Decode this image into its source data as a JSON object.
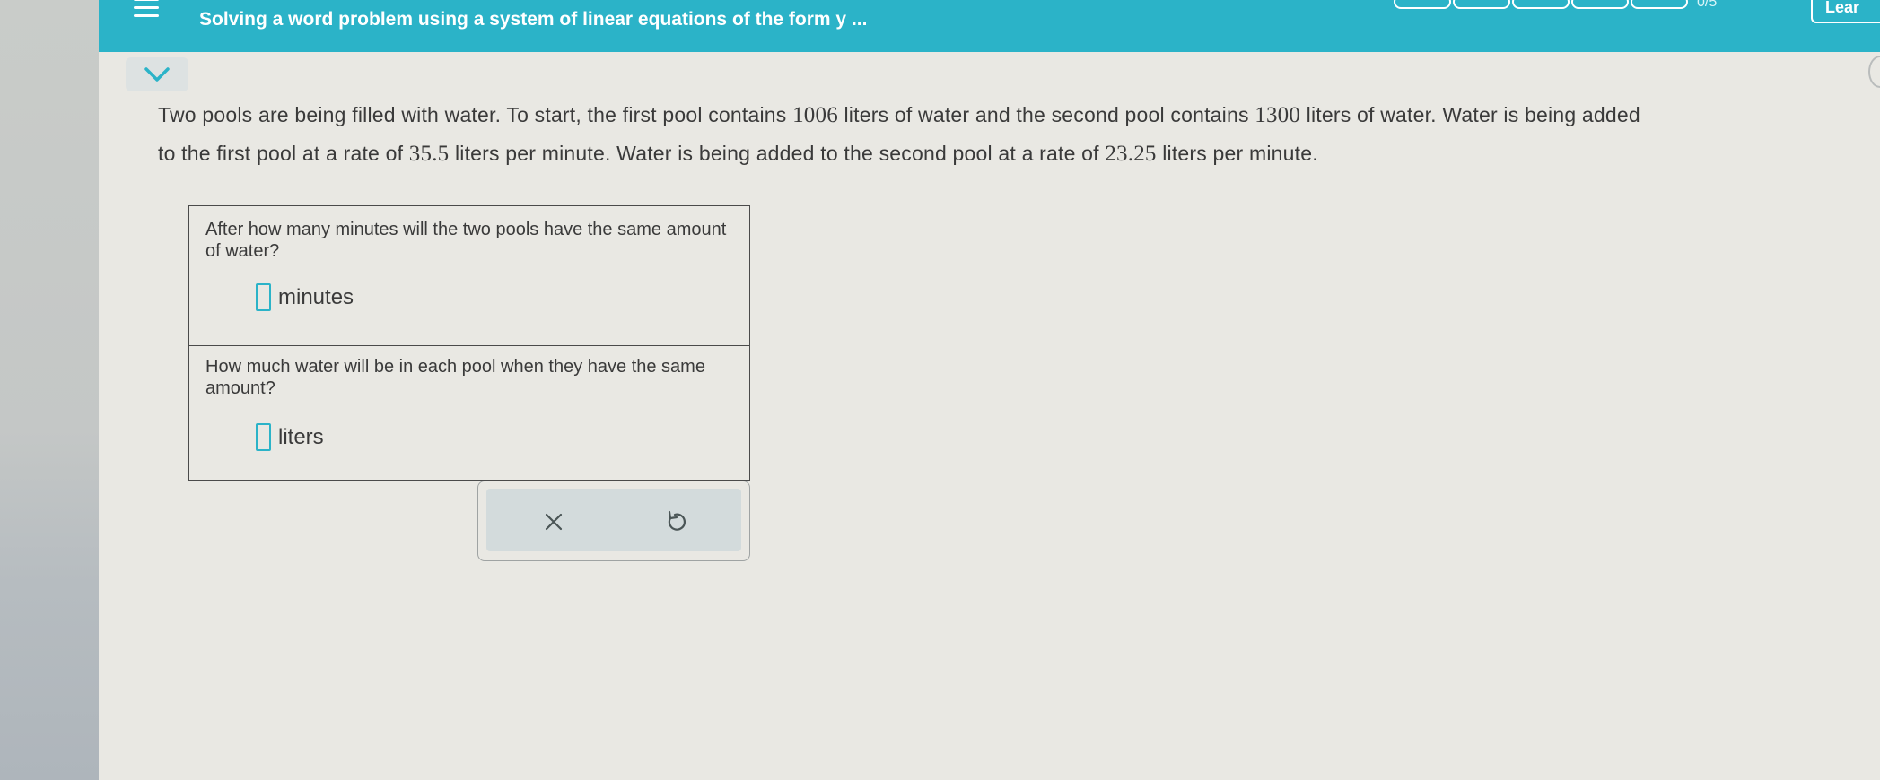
{
  "header": {
    "title": "Solving a word problem using a system of linear equations of the form y ...",
    "progress_count": "0/5",
    "progress_fraction": 0,
    "learn_label": "Lear",
    "accent_color": "#2bb3c8"
  },
  "problem": {
    "line1_a": "Two pools are being filled with water. To start, the first pool contains ",
    "line1_n1": "1006",
    "line1_b": " liters of water and the second pool contains ",
    "line1_n2": "1300",
    "line1_c": " liters of water. Water is being added",
    "line2_a": "to the first pool at a rate of ",
    "line2_n1": "35.5",
    "line2_b": " liters per minute. Water is being added to the second pool at a rate of ",
    "line2_n2": "23.25",
    "line2_c": " liters per minute."
  },
  "questions": [
    {
      "text": "After how many minutes will the two pools have the same amount of water?",
      "answer_value": "",
      "unit": "minutes"
    },
    {
      "text": "How much water will be in each pool when they have the same amount?",
      "answer_value": "",
      "unit": "liters"
    }
  ],
  "icons": {
    "menu": "hamburger-menu-icon",
    "collapse": "chevron-down-icon",
    "clear": "x-close-icon",
    "undo": "undo-icon"
  }
}
